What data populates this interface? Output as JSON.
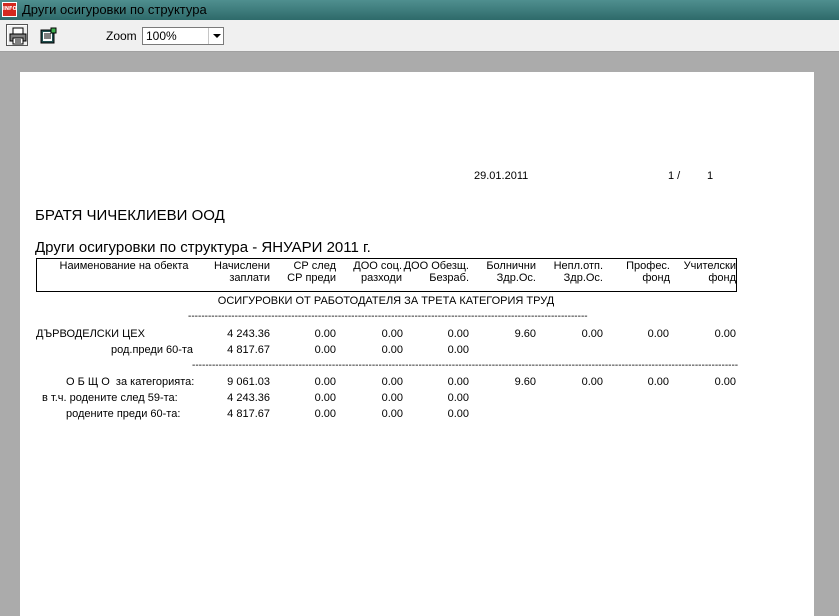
{
  "window": {
    "title": "Други осигуровки по структура",
    "app_icon_text": "INFO"
  },
  "toolbar": {
    "print_icon": "printer-icon",
    "export_icon": "export-icon",
    "zoom_label": "Zoom",
    "zoom_value": "100%"
  },
  "report": {
    "date": "29.01.2011",
    "page_current": "1 /",
    "page_total": "1",
    "company": "БРАТЯ ЧИЧЕКЛИЕВИ ООД",
    "title": "Други осигуровки по структура - ЯНУАРИ 2011 г.",
    "columns": [
      {
        "line1": "Наименование на обекта",
        "line2": ""
      },
      {
        "line1": "Начислени",
        "line2": "заплати"
      },
      {
        "line1": "СР след",
        "line2": "СР преди"
      },
      {
        "line1": "ДОО соц.",
        "line2": "разходи"
      },
      {
        "line1": "ДОО Обезщ.",
        "line2": "Безраб."
      },
      {
        "line1": "Болнични",
        "line2": "Здр.Ос."
      },
      {
        "line1": "Непл.отп.",
        "line2": "Здр.Ос."
      },
      {
        "line1": "Профес.",
        "line2": "фонд"
      },
      {
        "line1": "Учителски",
        "line2": "фонд"
      }
    ],
    "section_title": "ОСИГУРОВКИ ОТ РАБОТОДАТЕЛЯ ЗА ТРЕТА КАТЕГОРИЯ ТРУД",
    "rows": [
      {
        "label": "ДЪРВОДЕЛСКИ ЦЕХ",
        "values": [
          "4 243.36",
          "0.00",
          "0.00",
          "0.00",
          "9.60",
          "0.00",
          "0.00",
          "0.00"
        ]
      },
      {
        "label": "род.преди 60-та",
        "values": [
          "4 817.67",
          "0.00",
          "0.00",
          "0.00",
          "",
          "",
          "",
          ""
        ]
      },
      {
        "label": "О Б Щ О  за категорията:",
        "values": [
          "9 061.03",
          "0.00",
          "0.00",
          "0.00",
          "9.60",
          "0.00",
          "0.00",
          "0.00"
        ]
      },
      {
        "label": "в т.ч. родените след 59-та:",
        "values": [
          "4 243.36",
          "0.00",
          "0.00",
          "0.00",
          "",
          "",
          "",
          ""
        ]
      },
      {
        "label": "родените преди 60-та:",
        "values": [
          "4 817.67",
          "0.00",
          "0.00",
          "0.00",
          "",
          "",
          "",
          ""
        ]
      }
    ]
  }
}
